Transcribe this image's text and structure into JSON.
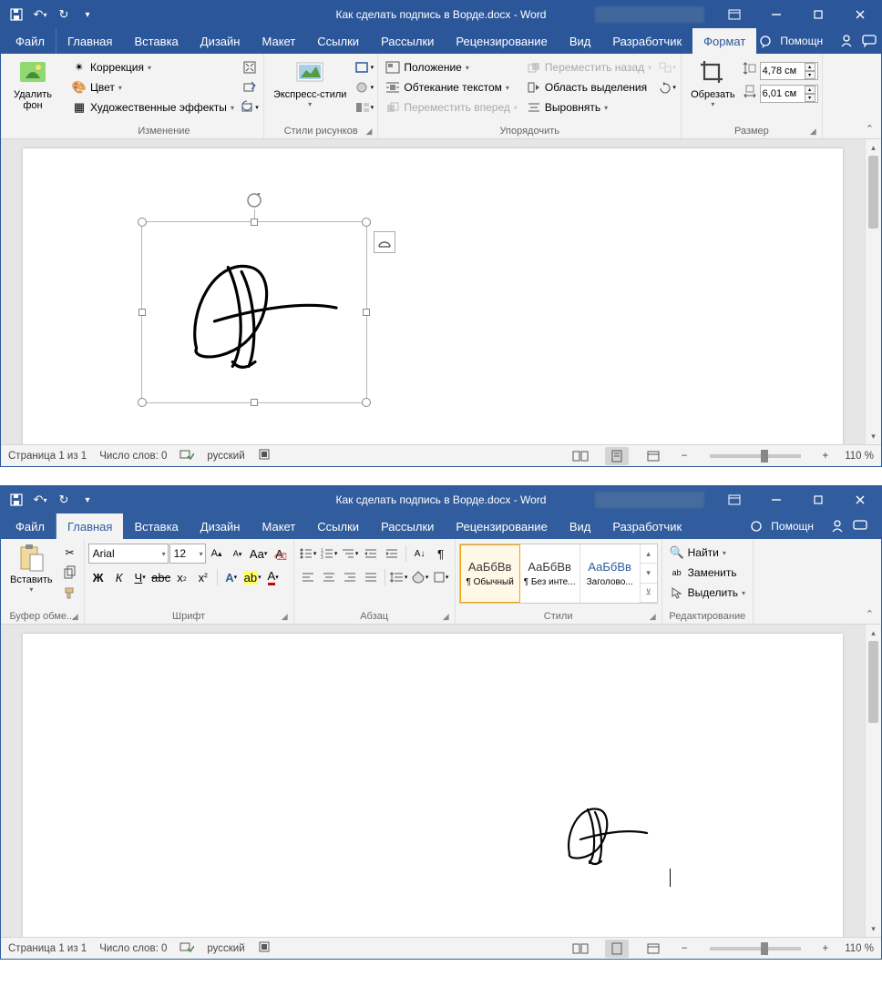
{
  "window1": {
    "title": "Как сделать подпись в Ворде.docx - Word",
    "tabs": [
      "Файл",
      "Главная",
      "Вставка",
      "Дизайн",
      "Макет",
      "Ссылки",
      "Рассылки",
      "Рецензирование",
      "Вид",
      "Разработчик"
    ],
    "format_tab": "Формат",
    "help_label": "Помощн",
    "ribbon": {
      "remove_bg": "Удалить фон",
      "corrections": "Коррекция",
      "color": "Цвет",
      "art_effects": "Художественные эффекты",
      "change_group": "Изменение",
      "express_styles": "Экспресс-стили",
      "picture_styles_group": "Стили рисунков",
      "position": "Положение",
      "wrap_text": "Обтекание текстом",
      "move_forward": "Переместить вперед",
      "move_backward": "Переместить назад",
      "selection_pane": "Область выделения",
      "align": "Выровнять",
      "arrange_group": "Упорядочить",
      "crop": "Обрезать",
      "height": "4,78 см",
      "width": "6,01 см",
      "size_group": "Размер"
    },
    "status": {
      "page": "Страница 1 из 1",
      "words": "Число слов: 0",
      "lang": "русский",
      "zoom": "110 %"
    }
  },
  "window2": {
    "title": "Как сделать подпись в Ворде.docx - Word",
    "tabs": [
      "Файл",
      "Главная",
      "Вставка",
      "Дизайн",
      "Макет",
      "Ссылки",
      "Рассылки",
      "Рецензирование",
      "Вид",
      "Разработчик"
    ],
    "help_label": "Помощн",
    "ribbon": {
      "paste": "Вставить",
      "clipboard_group": "Буфер обме...",
      "font_name": "Arial",
      "font_size": "12",
      "font_group": "Шрифт",
      "paragraph_group": "Абзац",
      "style1": "АаБбВв",
      "style1_name": "¶ Обычный",
      "style2": "АаБбВв",
      "style2_name": "¶ Без инте...",
      "style3": "АаБбВв",
      "style3_name": "Заголово...",
      "styles_group": "Стили",
      "find": "Найти",
      "replace": "Заменить",
      "select": "Выделить",
      "editing_group": "Редактирование"
    },
    "status": {
      "page": "Страница 1 из 1",
      "words": "Число слов: 0",
      "lang": "русский",
      "zoom": "110 %"
    }
  }
}
